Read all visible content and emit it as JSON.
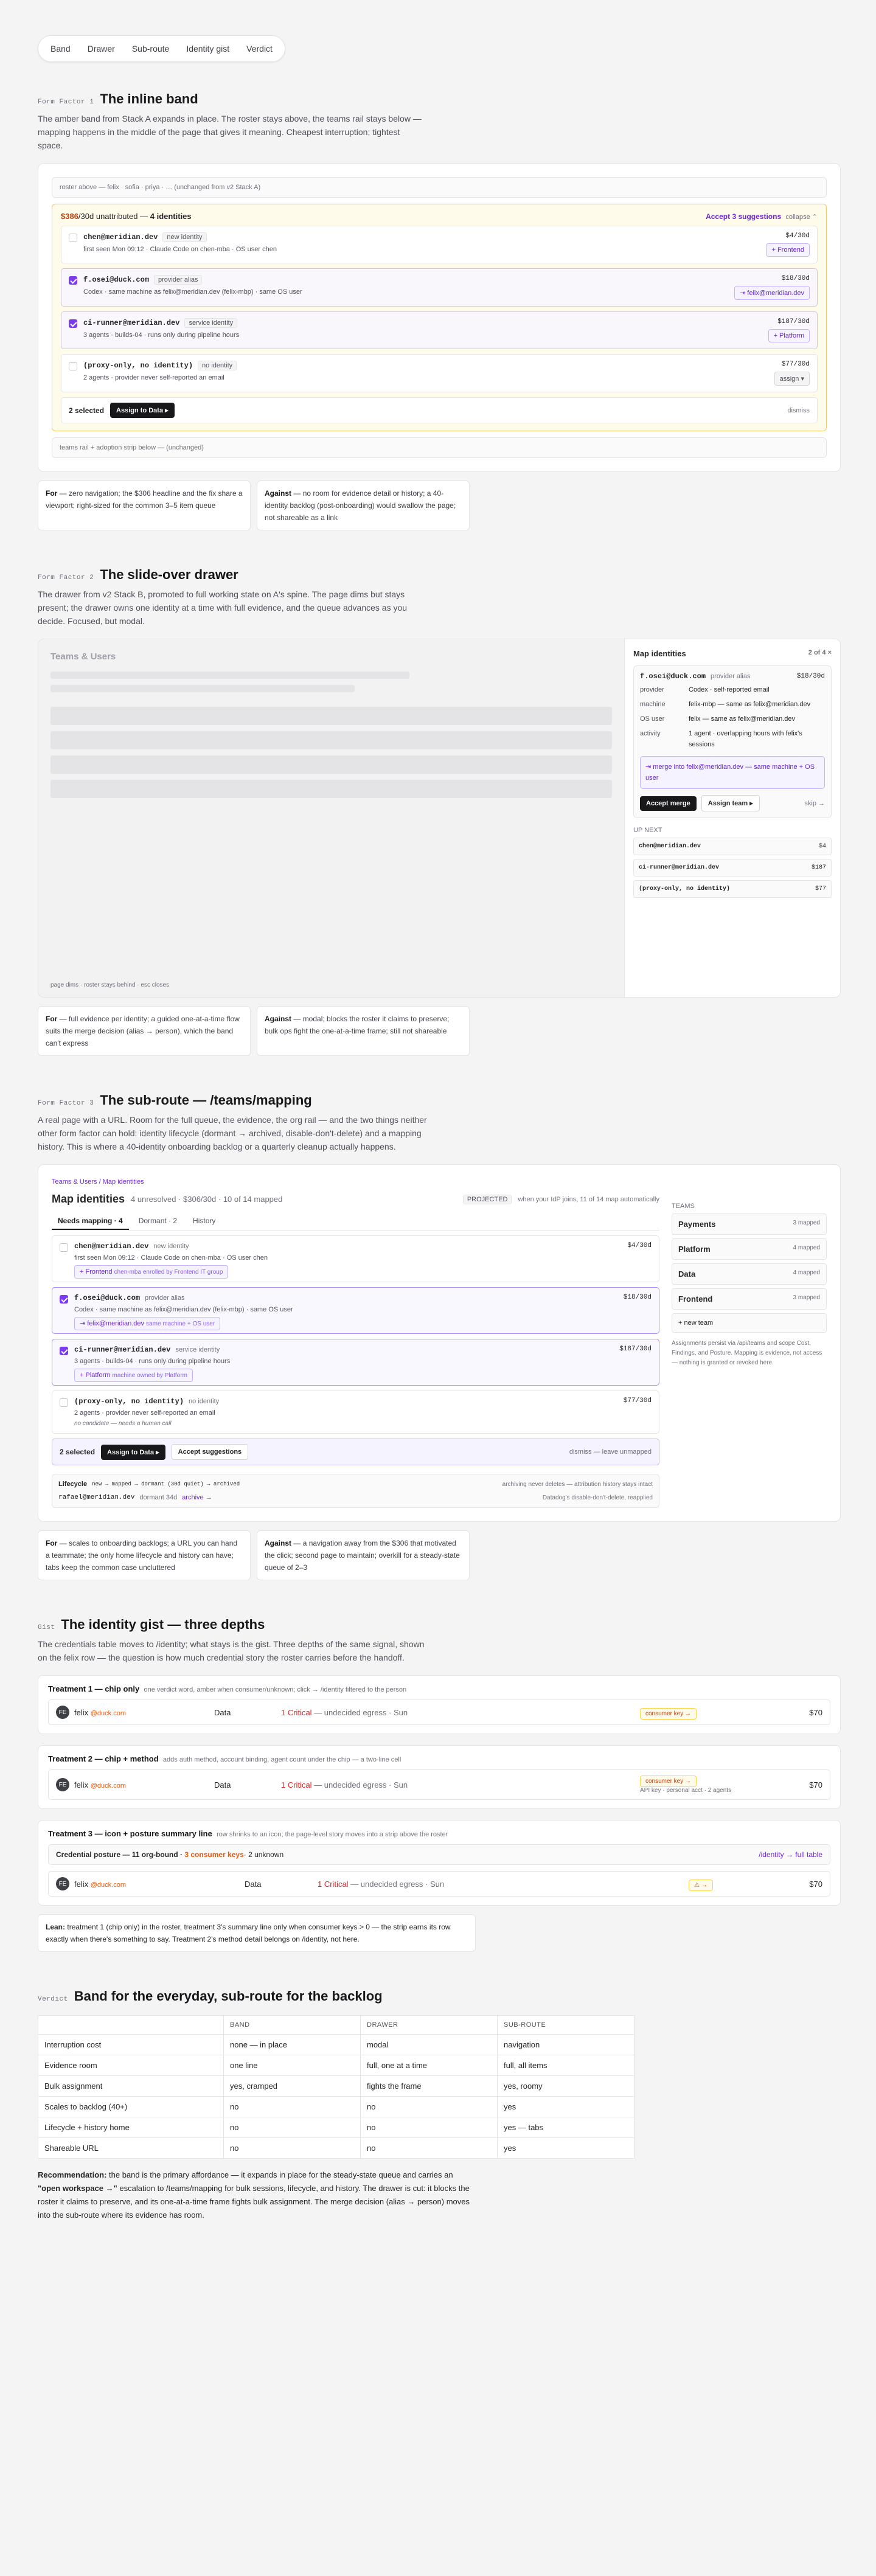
{
  "tabs": [
    "Band",
    "Drawer",
    "Sub-route",
    "Identity gist",
    "Verdict"
  ],
  "s1": {
    "label": "Form Factor 1",
    "title": "The inline band",
    "intro": "The amber band from Stack A expands in place. The roster stays above, the teams rail stays below — mapping happens in the middle of the page that gives it meaning. Cheapest interruption; tightest space.",
    "roster": "roster above — felix · sofia · priya · … (unchanged from v2 Stack A)",
    "amt": "$386",
    "amt_rest": "/30d unattributed — ",
    "ids": "4 identities",
    "accept": "Accept 3 suggestions",
    "collapse": "collapse ⌃",
    "rows": [
      {
        "id": "chen@meridian.dev",
        "tag": "new identity",
        "sub": "first seen Mon 09:12 · Claude Code on chen-mba · OS user chen",
        "price": "$4/30d",
        "chip": "+ Frontend"
      },
      {
        "id": "f.osei@duck.com",
        "tag": "provider alias",
        "sub": "Codex · same machine as felix@meridian.dev (felix-mbp) · same OS user",
        "price": "$18/30d",
        "chip": "⇥ felix@meridian.dev"
      },
      {
        "id": "ci-runner@meridian.dev",
        "tag": "service identity",
        "sub": "3 agents · builds-04 · runs only during pipeline hours",
        "price": "$187/30d",
        "chip": "+ Platform"
      },
      {
        "id": "(proxy-only, no identity)",
        "tag": "no identity",
        "sub": "2 agents · provider never self-reported an email",
        "price": "$77/30d",
        "chip": "assign ▾"
      }
    ],
    "selected": "2 selected",
    "assign": "Assign to Data ▸",
    "dismiss": "dismiss",
    "below": "teams rail + adoption strip below — (unchanged)",
    "for": "zero navigation; the $306 headline and the fix share a viewport; right-sized for the common 3–5 item queue",
    "against": "no room for evidence detail or history; a 40-identity backlog (post-onboarding) would swallow the page; not shareable as a link"
  },
  "s2": {
    "label": "Form Factor 2",
    "title": "The slide-over drawer",
    "intro": "The drawer from v2 Stack B, promoted to full working state on A's spine. The page dims but stays present; the drawer owns one identity at a time with full evidence, and the queue advances as you decide. Focused, but modal.",
    "teams": "Teams & Users",
    "foot": "page dims · roster stays behind · esc closes",
    "dtitle": "Map identities",
    "count": "2 of 4 ×",
    "did": "f.osei@duck.com",
    "dtag": "provider alias",
    "dprice": "$18/30d",
    "kv": [
      {
        "k": "provider",
        "v": "Codex · self-reported email"
      },
      {
        "k": "machine",
        "v": "felix-mbp — same as felix@meridian.dev"
      },
      {
        "k": "OS user",
        "v": "felix — same as felix@meridian.dev"
      },
      {
        "k": "activity",
        "v": "1 agent · overlapping hours with felix's sessions"
      }
    ],
    "merge": "⇥ merge into felix@meridian.dev — same machine + OS user",
    "mbtn": "Accept merge",
    "abtn": "Assign team ▸",
    "skip": "skip →",
    "upnext": "UP NEXT",
    "up": [
      {
        "id": "chen@meridian.dev",
        "p": "$4"
      },
      {
        "id": "ci-runner@meridian.dev",
        "p": "$187"
      },
      {
        "id": "(proxy-only, no identity)",
        "p": "$77"
      }
    ],
    "for": "full evidence per identity; a guided one-at-a-time flow suits the merge decision (alias → person), which the band can't express",
    "against": "modal; blocks the roster it claims to preserve; bulk ops fight the one-at-a-time frame; still not shareable"
  },
  "s3": {
    "label": "Form Factor 3",
    "title": "The sub-route — /teams/mapping",
    "intro": "A real page with a URL. Room for the full queue, the evidence, the org rail — and the two things neither other form factor can hold: identity lifecycle (dormant → archived, disable-don't-delete) and a mapping history. This is where a 40-identity onboarding backlog or a quarterly cleanup actually happens.",
    "crumb": "Teams & Users / Map identities",
    "title2": "Map identities",
    "meta": "4 unresolved · $306/30d · 10 of 14 mapped",
    "proj": "PROJECTED",
    "projn": "when your IdP joins, 11 of 14 map automatically",
    "stabs": [
      "Needs mapping · 4",
      "Dormant · 2",
      "History"
    ],
    "rows": [
      {
        "id": "chen@meridian.dev",
        "tag": "new identity",
        "sub": "first seen Mon 09:12 · Claude Code on chen-mba · OS user chen",
        "price": "$4/30d",
        "chip": "+ Frontend",
        "chipn": "chen-mba enrolled by Frontend IT group"
      },
      {
        "id": "f.osei@duck.com",
        "tag": "provider alias",
        "sub": "Codex · same machine as felix@meridian.dev (felix-mbp) · same OS user",
        "price": "$18/30d",
        "chip": "⇥ felix@meridian.dev",
        "chipn": "same machine + OS user"
      },
      {
        "id": "ci-runner@meridian.dev",
        "tag": "service identity",
        "sub": "3 agents · builds-04 · runs only during pipeline hours",
        "price": "$187/30d",
        "chip": "+ Platform",
        "chipn": "machine owned by Platform"
      },
      {
        "id": "(proxy-only, no identity)",
        "tag": "no identity",
        "sub": "2 agents · provider never self-reported an email",
        "price": "$77/30d",
        "chip": "",
        "chipn": "no candidate — needs a human call"
      }
    ],
    "selected": "2 selected",
    "assign": "Assign to Data ▸",
    "accept": "Accept suggestions",
    "dismiss": "dismiss — leave unmapped",
    "life": "Lifecycle",
    "lifeflow": "new → mapped → dormant (30d quiet) → archived",
    "lifenote": "archiving never deletes — attribution history stays intact",
    "dorm": "rafael@meridian.dev",
    "dormt": "dormant 34d",
    "archive": "archive →",
    "dormnote": "Datadog's disable-don't-delete, reapplied",
    "teamsh": "TEAMS",
    "teams": [
      {
        "n": "Payments",
        "c": "3 mapped"
      },
      {
        "n": "Platform",
        "c": "4 mapped"
      },
      {
        "n": "Data",
        "c": "4 mapped"
      },
      {
        "n": "Frontend",
        "c": "3 mapped"
      }
    ],
    "newteam": "+ new team",
    "teamnote": "Assignments persist via /api/teams and scope Cost, Findings, and Posture. Mapping is evidence, not access — nothing is granted or revoked here.",
    "for": "scales to onboarding backlogs; a URL you can hand a teammate; the only home lifecycle and history can have; tabs keep the common case uncluttered",
    "against": "a navigation away from the $306 that motivated the click; second page to maintain; overkill for a steady-state queue of 2–3"
  },
  "s4": {
    "label": "Gist",
    "title": "The identity gist — three depths",
    "intro": "The credentials table moves to /identity; what stays is the gist. Three depths of the same signal, shown on the felix row — the question is how much credential story the roster carries before the handoff.",
    "t1": "Treatment 1 — chip only",
    "t1n": "one verdict word, amber when consumer/unknown; click → /identity filtered to the person",
    "t2": "Treatment 2 — chip + method",
    "t2n": "adds auth method, account binding, agent count under the chip — a two-line cell",
    "t3": "Treatment 3 — icon + posture summary line",
    "t3n": "row shrinks to an icon; the page-level story moves into a strip above the roster",
    "posture": "Credential posture — 11 org-bound · ",
    "postamb": "3 consumer keys",
    "postrest": " · 2 unknown",
    "full": "/identity → full table",
    "name": "felix",
    "dom": "@duck.com",
    "team": "Data",
    "crit": "1 Critical",
    "critrest": " — undecided egress · Sun",
    "key": "consumer key →",
    "keysub": "API key · personal acct · 2 agents",
    "warn": "⚠ →",
    "amt": "$70",
    "lean": "treatment 1 (chip only) in the roster, treatment 3's summary line only when consumer keys > 0 — the strip earns its row exactly when there's something to say. Treatment 2's method detail belongs on /identity, not here."
  },
  "s5": {
    "label": "Verdict",
    "title": "Band for the everyday, sub-route for the backlog",
    "head": [
      "",
      "BAND",
      "DRAWER",
      "SUB-ROUTE"
    ],
    "rows": [
      [
        "Interruption cost",
        "none — in place",
        "modal",
        "navigation"
      ],
      [
        "Evidence room",
        "one line",
        "full, one at a time",
        "full, all items"
      ],
      [
        "Bulk assignment",
        "yes, cramped",
        "fights the frame",
        "yes, roomy"
      ],
      [
        "Scales to backlog (40+)",
        "no",
        "no",
        "yes"
      ],
      [
        "Lifecycle + history home",
        "no",
        "no",
        "yes — tabs"
      ],
      [
        "Shareable URL",
        "no",
        "no",
        "yes"
      ]
    ],
    "rec1": "Recommendation:",
    "rec2": " the band is the primary affordance — it expands in place for the steady-state queue and carries an ",
    "rec3": "\"open workspace →\"",
    "rec4": " escalation to /teams/mapping for bulk sessions, lifecycle, and history. The drawer is cut: it blocks the roster it claims to preserve, and its one-at-a-time frame fights bulk assignment. The merge decision (alias → person) moves into the sub-route where its evidence has room."
  },
  "lbl": {
    "for": "For",
    "against": "Against",
    "lean": "Lean:"
  }
}
